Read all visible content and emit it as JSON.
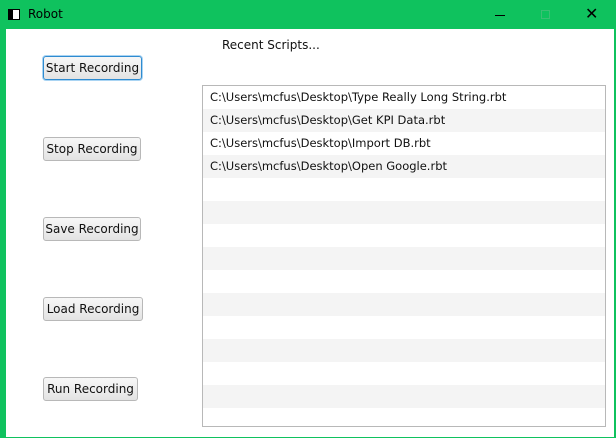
{
  "window": {
    "title": "Robot",
    "icon": "app-window-icon",
    "controls": {
      "minimize_icon": "minimize-icon",
      "maximize_icon": "maximize-icon",
      "close_icon": "close-icon",
      "close_glyph": "✕"
    },
    "titlebar_color": "#0fc25e"
  },
  "buttons": {
    "start": "Start Recording",
    "stop": "Stop Recording",
    "save": "Save Recording",
    "load": "Load Recording",
    "run": "Run Recording"
  },
  "recent": {
    "label": "Recent Scripts...",
    "items": [
      "C:\\Users\\mcfus\\Desktop\\Type Really Long String.rbt",
      "C:\\Users\\mcfus\\Desktop\\Get KPI Data.rbt",
      "C:\\Users\\mcfus\\Desktop\\Import DB.rbt",
      "C:\\Users\\mcfus\\Desktop\\Open Google.rbt",
      "",
      "",
      "",
      "",
      "",
      "",
      "",
      "",
      "",
      ""
    ]
  }
}
